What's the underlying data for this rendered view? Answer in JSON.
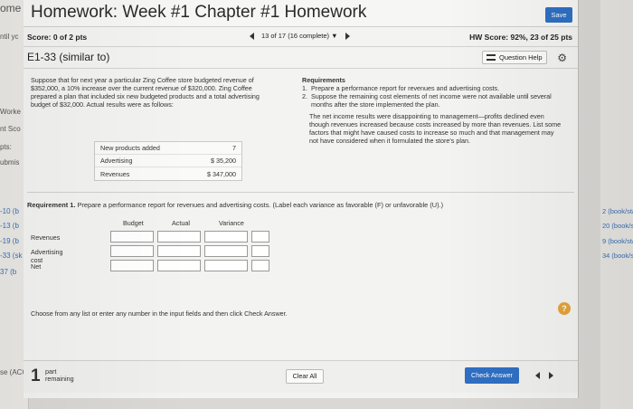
{
  "background": {
    "left_fragments": [
      "ome",
      "ntil yc",
      "Worke",
      "nt Sco",
      "pts:",
      "ubmis",
      "-10 (b",
      "-13 (b",
      "-19 (b",
      "-33 (sk",
      "37 (b",
      "se (ACC"
    ],
    "right_fragments": [
      "2 (book/static) (",
      "20 (book/static)",
      "9 (book/static) (",
      "34 (book/static) ("
    ]
  },
  "header": {
    "title": "Homework: Week #1 Chapter #1 Homework",
    "save_label": "Save"
  },
  "scorebar": {
    "score": "Score: 0 of 2 pts",
    "progress": "13 of 17 (16 complete)",
    "progress_caret": "▼",
    "hw_score": "HW Score: 92%, 23 of 25 pts"
  },
  "question": {
    "title": "E1-33 (similar to)",
    "help_label": "Question Help",
    "gear_glyph": "⚙"
  },
  "problem": {
    "text": "Suppose that for next year a particular Zing Coffee store budgeted revenue of $352,000, a 10% increase over the current revenue of $320,000. Zing Coffee prepared a plan that included six new budgeted products and a total advertising budget of $32,000. Actual results were as follows:",
    "table": [
      {
        "label": "New products added",
        "value": "7"
      },
      {
        "label": "Advertising",
        "value": "$  35,200"
      },
      {
        "label": "Revenues",
        "value": "$  347,000"
      }
    ]
  },
  "requirements": {
    "heading": "Requirements",
    "items": [
      {
        "num": "1.",
        "text": "Prepare a performance report for revenues and advertising costs."
      },
      {
        "num": "2.",
        "text": "Suppose the remaining cost elements of net income were not available until several months after the store implemented the plan."
      }
    ],
    "para": "The net income results were disappointing to management—profits declined even though revenues increased because costs increased by more than revenues. List some factors that might have caused costs to increase so much and that management may not have considered when it formulated the store's plan."
  },
  "req1": {
    "bold": "Requirement 1.",
    "text": " Prepare a performance report for revenues and advertising costs. (Label each variance as favorable (F) or unfavorable (U).)"
  },
  "report": {
    "headers": [
      "Budget",
      "Actual",
      "Variance"
    ],
    "rows": [
      "Revenues",
      "Advertising cost",
      "Net"
    ]
  },
  "hint": "Choose from any list or enter any number in the input fields and then click Check Answer.",
  "help_mark": "?",
  "footer": {
    "parts_count": "1",
    "parts_label_1": "part",
    "parts_label_2": "remaining",
    "clear_label": "Clear All",
    "check_label": "Check Answer"
  }
}
